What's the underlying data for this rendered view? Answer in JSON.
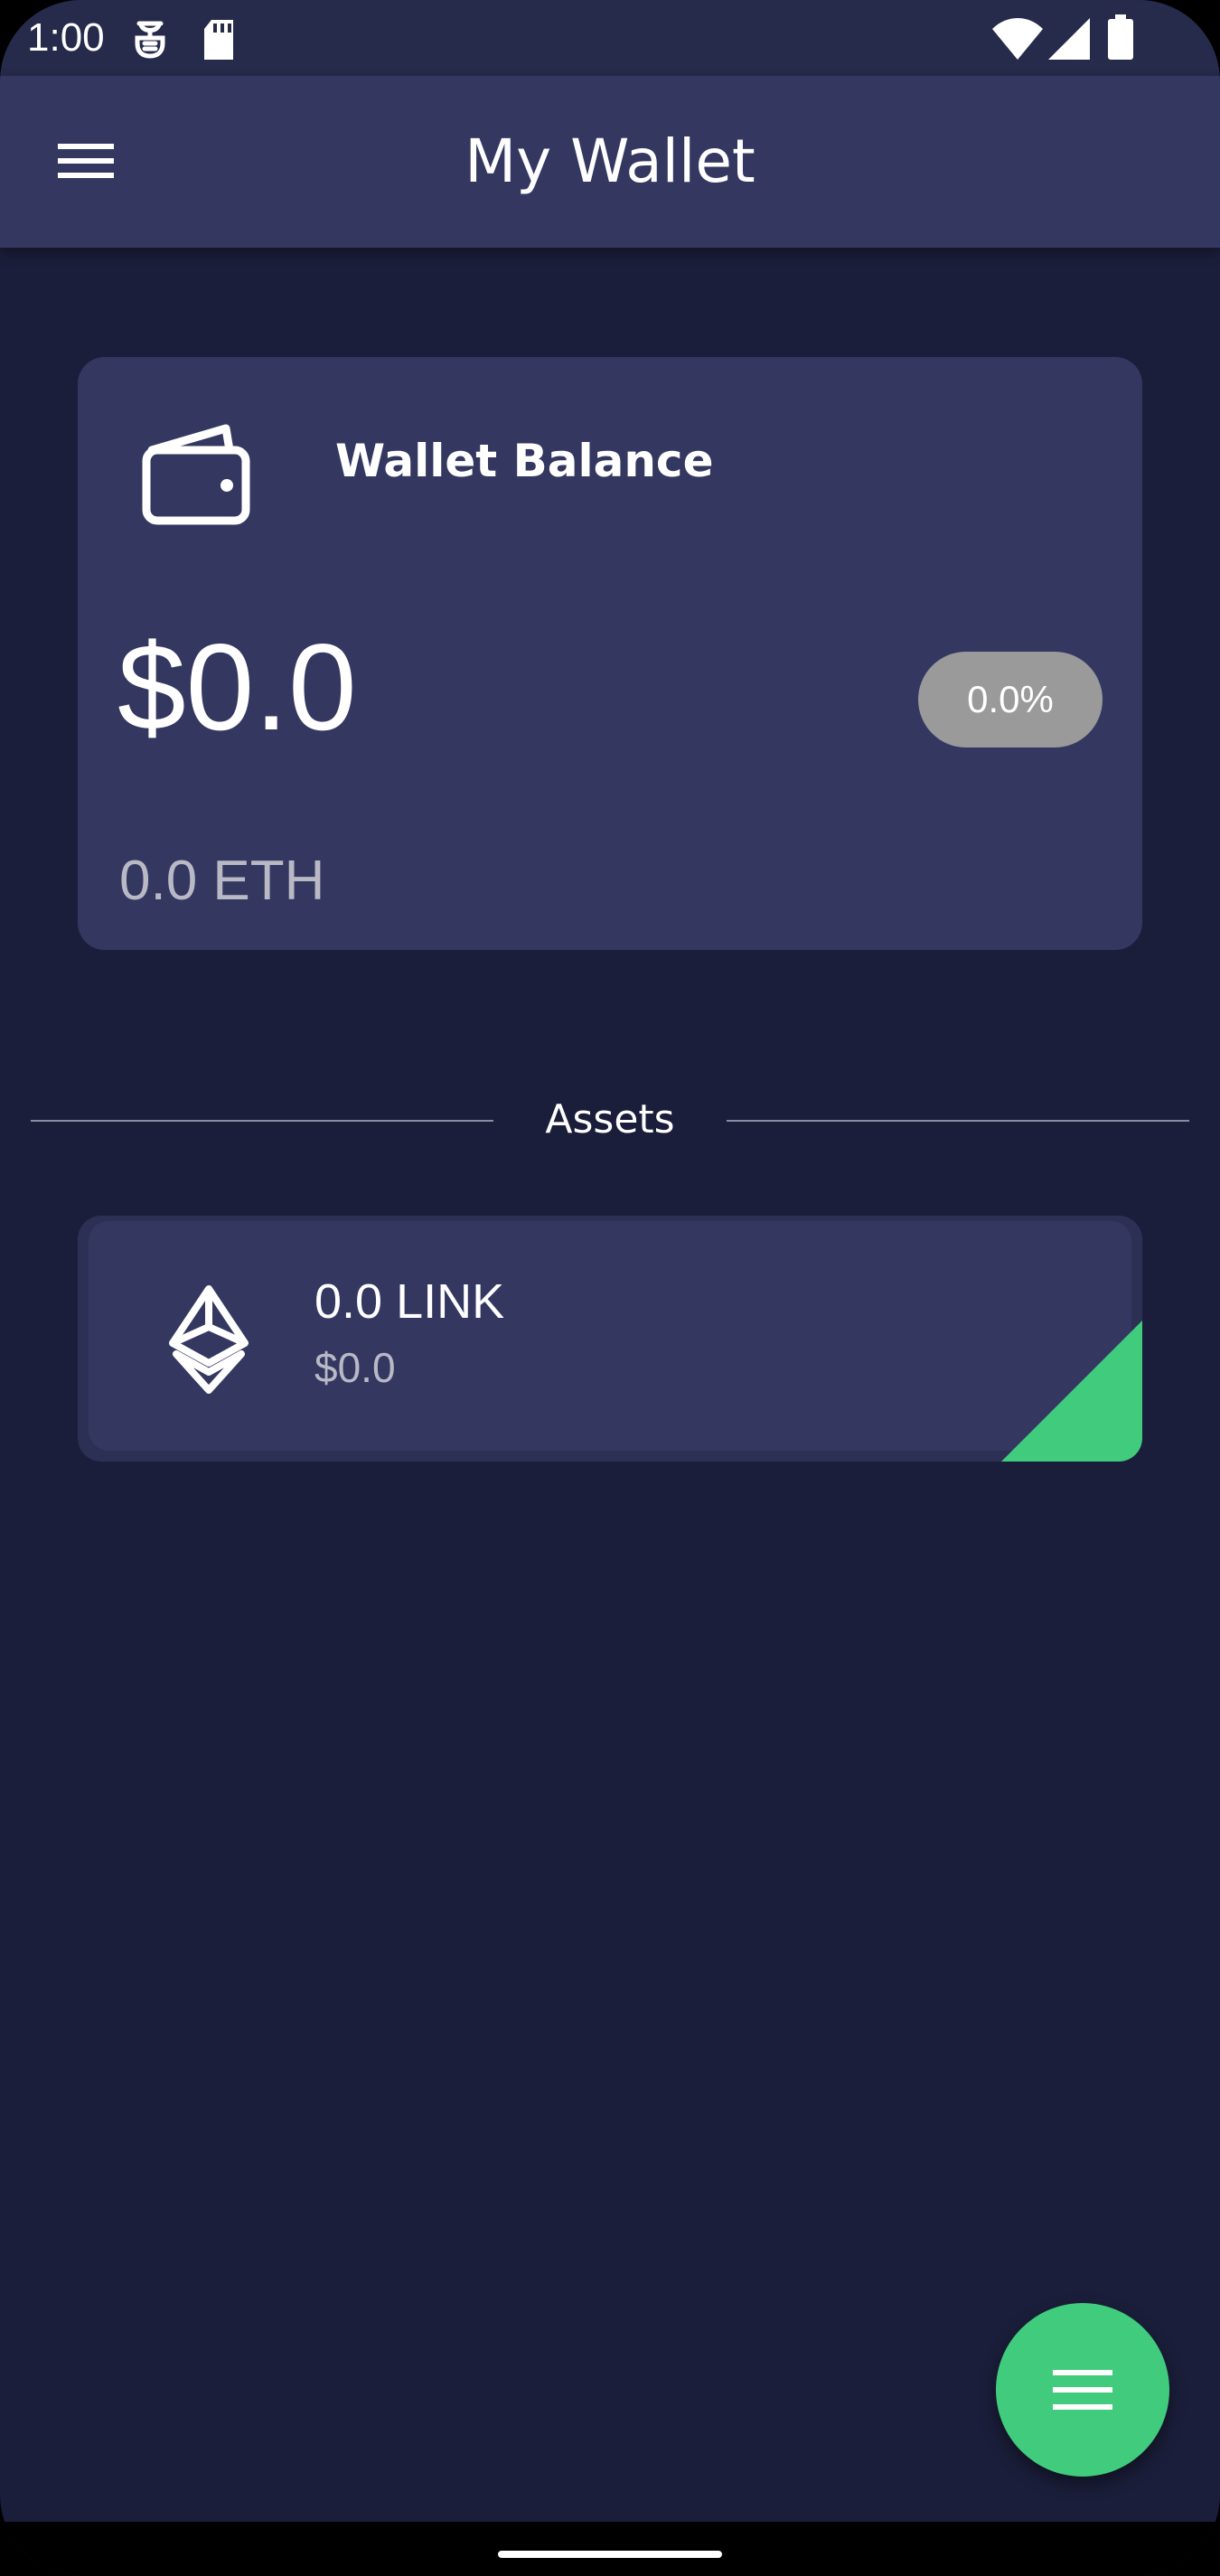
{
  "status_bar": {
    "time": "1:00",
    "icons": [
      "notification-icon",
      "sd-card-icon",
      "wifi-icon",
      "signal-icon",
      "battery-icon"
    ]
  },
  "app_bar": {
    "title": "My Wallet",
    "menu_icon": "menu-icon"
  },
  "balance_card": {
    "icon": "wallet-icon",
    "title": "Wallet Balance",
    "balance_usd": "$0.0",
    "change_percent": "0.0%",
    "balance_eth": "0.0 ETH"
  },
  "assets_section": {
    "label": "Assets",
    "items": [
      {
        "icon": "ethereum-icon",
        "amount": "0.0 LINK",
        "value": "$0.0"
      }
    ]
  },
  "fab": {
    "icon": "menu-icon"
  },
  "colors": {
    "background": "#1b1e3a",
    "surface": "#343861",
    "accent_green": "#40cb7d",
    "badge_gray": "#9a9a9a"
  }
}
